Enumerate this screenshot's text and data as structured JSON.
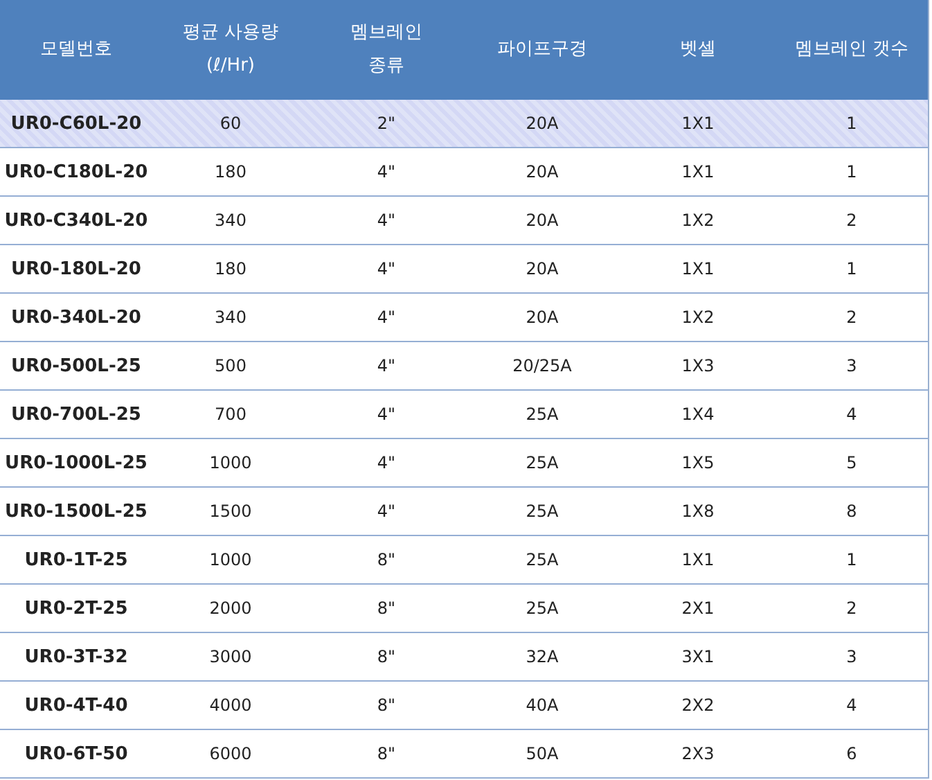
{
  "table": {
    "columns": [
      "모델번호",
      "평균 사용량\n(ℓ/Hr)",
      "멤브레인\n종류",
      "파이프구경",
      "벳셀",
      "멤브레인 갯수"
    ],
    "rows": [
      {
        "selected": true,
        "cells": [
          "UR0-C60L-20",
          "60",
          "2\"",
          "20A",
          "1X1",
          "1"
        ]
      },
      {
        "selected": false,
        "cells": [
          "UR0-C180L-20",
          "180",
          "4\"",
          "20A",
          "1X1",
          "1"
        ]
      },
      {
        "selected": false,
        "cells": [
          "UR0-C340L-20",
          "340",
          "4\"",
          "20A",
          "1X2",
          "2"
        ]
      },
      {
        "selected": false,
        "cells": [
          "UR0-180L-20",
          "180",
          "4\"",
          "20A",
          "1X1",
          "1"
        ]
      },
      {
        "selected": false,
        "cells": [
          "UR0-340L-20",
          "340",
          "4\"",
          "20A",
          "1X2",
          "2"
        ]
      },
      {
        "selected": false,
        "cells": [
          "UR0-500L-25",
          "500",
          "4\"",
          "20/25A",
          "1X3",
          "3"
        ]
      },
      {
        "selected": false,
        "cells": [
          "UR0-700L-25",
          "700",
          "4\"",
          "25A",
          "1X4",
          "4"
        ]
      },
      {
        "selected": false,
        "cells": [
          "UR0-1000L-25",
          "1000",
          "4\"",
          "25A",
          "1X5",
          "5"
        ]
      },
      {
        "selected": false,
        "cells": [
          "UR0-1500L-25",
          "1500",
          "4\"",
          "25A",
          "1X8",
          "8"
        ]
      },
      {
        "selected": false,
        "cells": [
          "UR0-1T-25",
          "1000",
          "8\"",
          "25A",
          "1X1",
          "1"
        ]
      },
      {
        "selected": false,
        "cells": [
          "UR0-2T-25",
          "2000",
          "8\"",
          "25A",
          "2X1",
          "2"
        ]
      },
      {
        "selected": false,
        "cells": [
          "UR0-3T-32",
          "3000",
          "8\"",
          "32A",
          "3X1",
          "3"
        ]
      },
      {
        "selected": false,
        "cells": [
          "UR0-4T-40",
          "4000",
          "8\"",
          "40A",
          "2X2",
          "4"
        ]
      },
      {
        "selected": false,
        "cells": [
          "UR0-6T-50",
          "6000",
          "8\"",
          "50A",
          "2X3",
          "6"
        ]
      }
    ]
  }
}
